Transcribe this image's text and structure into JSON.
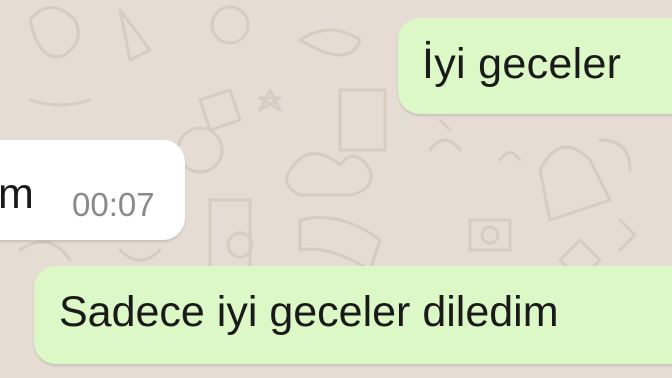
{
  "chat": {
    "messages": [
      {
        "direction": "outgoing",
        "text": "İyi geceler",
        "time": ""
      },
      {
        "direction": "incoming",
        "text": "m",
        "time": "00:07"
      },
      {
        "direction": "outgoing",
        "text": "Sadece iyi geceler diledim",
        "time": ""
      }
    ]
  },
  "colors": {
    "wallpaper": "#e5ddd3",
    "outgoing_bubble": "#dcf8c6",
    "incoming_bubble": "#ffffff",
    "timestamp": "#8a8a8a"
  }
}
